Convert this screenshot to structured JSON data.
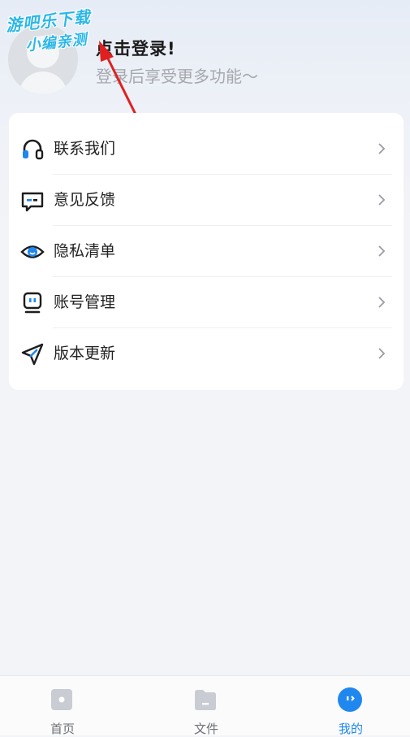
{
  "watermark": {
    "line1": "游吧乐下载",
    "line2": "小编亲测"
  },
  "profile": {
    "title": "点击登录!",
    "subtitle": "登录后享受更多功能～"
  },
  "menu": [
    {
      "label": "联系我们",
      "icon": "headset-icon"
    },
    {
      "label": "意见反馈",
      "icon": "feedback-icon"
    },
    {
      "label": "隐私清单",
      "icon": "privacy-eye-icon"
    },
    {
      "label": "账号管理",
      "icon": "account-icon"
    },
    {
      "label": "版本更新",
      "icon": "paper-plane-icon"
    }
  ],
  "tabs": [
    {
      "label": "首页",
      "icon": "home-icon"
    },
    {
      "label": "文件",
      "icon": "folder-icon"
    },
    {
      "label": "我的",
      "icon": "profile-face-icon",
      "active": true
    }
  ],
  "colors": {
    "accent": "#1f87ee",
    "arrow": "#e02020"
  }
}
